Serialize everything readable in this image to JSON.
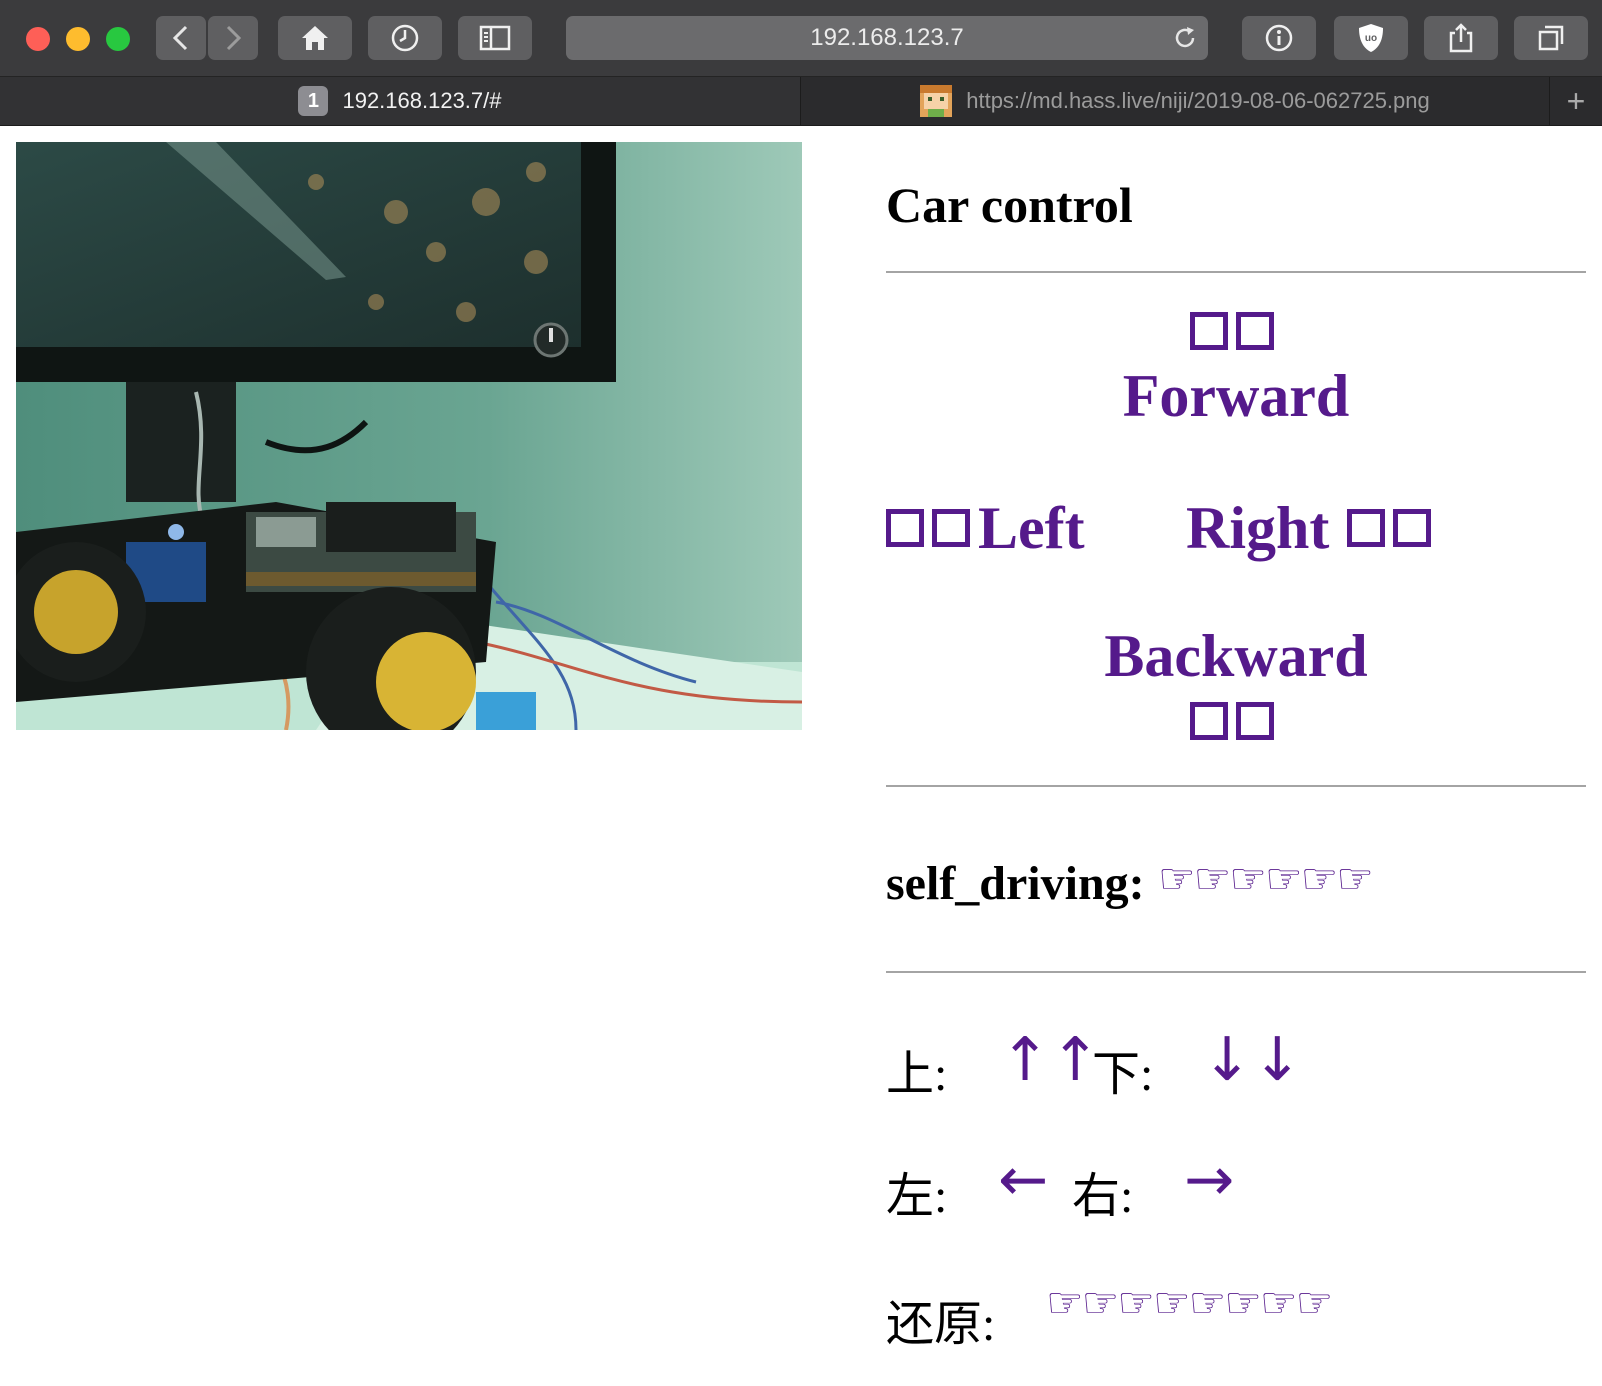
{
  "browser": {
    "url": "192.168.123.7",
    "tabs": [
      {
        "number": "1",
        "label": "192.168.123.7/#",
        "active": true
      },
      {
        "label": "https://md.hass.live/niji/2019-08-06-062725.png",
        "active": false
      }
    ],
    "new_tab": "+"
  },
  "page": {
    "title": "Car control",
    "controls": {
      "forward": "Forward",
      "left": "Left",
      "right": "Right",
      "backward": "Backward"
    },
    "self_driving": {
      "label": "self_driving:",
      "hands": "☞☞☞☞☞☞"
    },
    "camera_pan": {
      "up_label": "上:",
      "up_arrows": "↑↑",
      "down_label": "下:",
      "down_arrows": "↓↓",
      "left_label": "左:",
      "left_arrow": "←",
      "right_label": "右:",
      "right_arrow": "→"
    },
    "reset": {
      "label": "还原:",
      "hands": "☞☞☞☞☞☞☞☞"
    }
  },
  "colors": {
    "link": "#551a8b",
    "toolbar": "#3b3b3d",
    "tabbar": "#2b2b2d"
  }
}
